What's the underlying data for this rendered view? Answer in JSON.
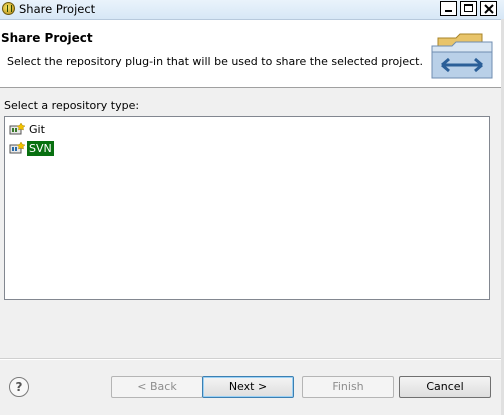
{
  "window": {
    "title": "Share Project"
  },
  "header": {
    "title": "Share Project",
    "description": "Select the repository plug-in that will be used to share the selected project."
  },
  "repo_section": {
    "label": "Select a repository type:",
    "items": [
      {
        "label": "Git",
        "icon": "git-repo-icon",
        "selected": false
      },
      {
        "label": "SVN",
        "icon": "svn-repo-icon",
        "selected": true
      }
    ]
  },
  "buttons": {
    "help": "?",
    "back": "< Back",
    "next": "Next >",
    "finish": "Finish",
    "cancel": "Cancel"
  },
  "colors": {
    "selection": "#087010"
  }
}
